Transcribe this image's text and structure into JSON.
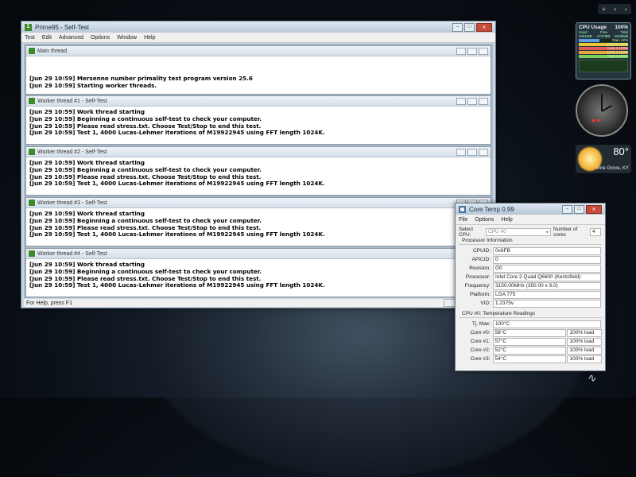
{
  "prime95": {
    "title": "Prime95 - Self-Test",
    "menu": [
      "Test",
      "Edit",
      "Advanced",
      "Options",
      "Window",
      "Help"
    ],
    "status": "For Help, press F1",
    "main_thread": {
      "title": "Main thread",
      "lines": [
        "[Jun 29 10:59] Mersenne number primality test program version 25.6",
        "[Jun 29 10:59] Starting worker threads."
      ]
    },
    "workers": [
      {
        "title": "Worker thread #1 - Self-Test",
        "lines": [
          "[Jun 29 10:59] Work thread starting",
          "[Jun 29 10:59] Beginning a continuous self-test to check your computer.",
          "[Jun 29 10:59] Please read stress.txt.  Choose Test/Stop to end this test.",
          "[Jun 29 10:59] Test 1, 4000 Lucas-Lehmer iterations of M19922945 using FFT length 1024K."
        ]
      },
      {
        "title": "Worker thread #2 - Self-Test",
        "lines": [
          "[Jun 29 10:59] Work thread starting",
          "[Jun 29 10:59] Beginning a continuous self-test to check your computer.",
          "[Jun 29 10:59] Please read stress.txt.  Choose Test/Stop to end this test.",
          "[Jun 29 10:59] Test 1, 4000 Lucas-Lehmer iterations of M19922945 using FFT length 1024K."
        ]
      },
      {
        "title": "Worker thread #3 - Self-Test",
        "lines": [
          "[Jun 29 10:59] Work thread starting",
          "[Jun 29 10:59] Beginning a continuous self-test to check your computer.",
          "[Jun 29 10:59] Please read stress.txt.  Choose Test/Stop to end this test.",
          "[Jun 29 10:59] Test 1, 4000 Lucas-Lehmer iterations of M19922945 using FFT length 1024K."
        ]
      },
      {
        "title": "Worker thread #4 - Self-Test",
        "lines": [
          "[Jun 29 10:59] Work thread starting",
          "[Jun 29 10:59] Beginning a continuous self-test to check your computer.",
          "[Jun 29 10:59] Please read stress.txt.  Choose Test/Stop to end this test.",
          "[Jun 29 10:59] Test 1, 4000 Lucas-Lehmer iterations of M19922945 using FFT length 1024K."
        ]
      }
    ]
  },
  "coretemp": {
    "title": "Core Temp 0.99",
    "menu": [
      "File",
      "Options",
      "Help"
    ],
    "select_cpu_label": "Select CPU:",
    "select_cpu_value": "CPU #0",
    "num_cores_label": "Number of cores",
    "num_cores_value": "4",
    "proc_info_label": "Processor Information",
    "info": [
      {
        "label": "CPUID:",
        "value": "0x6FB"
      },
      {
        "label": "APICID:",
        "value": "0"
      },
      {
        "label": "Revision:",
        "value": "G0"
      },
      {
        "label": "Processor:",
        "value": "Intel Core 2 Quad Q6600 (Kentsfield)"
      },
      {
        "label": "Frequency:",
        "value": "3150.00MHz (350.00 x 9.0)"
      },
      {
        "label": "Platform:",
        "value": "LGA 775"
      },
      {
        "label": "VID:",
        "value": "1.2375v"
      }
    ],
    "temps_label": "CPU #0: Temperature Readings",
    "tjmax_label": "Tj. Max:",
    "tjmax_value": "100°C",
    "cores": [
      {
        "label": "Core #0:",
        "temp": "58°C",
        "load": "100% load"
      },
      {
        "label": "Core #1:",
        "temp": "57°C",
        "load": "100% load"
      },
      {
        "label": "Core #2:",
        "temp": "52°C",
        "load": "100% load"
      },
      {
        "label": "Core #3:",
        "temp": "54°C",
        "load": "100% load"
      }
    ]
  },
  "gadgets": {
    "top_buttons": [
      "+",
      "‹",
      "›"
    ],
    "cpu": {
      "title": "CPU Usage",
      "total": "100%",
      "stats": [
        {
          "label": "Used",
          "value": "3451MB"
        },
        {
          "label": "Free",
          "value": "4737MB"
        },
        {
          "label": "Total",
          "value": "8188MB"
        }
      ],
      "ram_label": "Ram",
      "ram_pct": "42%",
      "ram_level": 0.42,
      "cores": [
        {
          "label": "Core 1",
          "pct": "100%",
          "level": 1.0
        },
        {
          "label": "Core 2",
          "pct": "100%",
          "level": 1.0
        },
        {
          "label": "Core 3",
          "pct": "100%",
          "level": 1.0
        },
        {
          "label": "Core 4",
          "pct": "100%",
          "level": 1.0
        }
      ]
    },
    "weather": {
      "temp": "80°",
      "location": "Vine Grove, KY"
    }
  }
}
